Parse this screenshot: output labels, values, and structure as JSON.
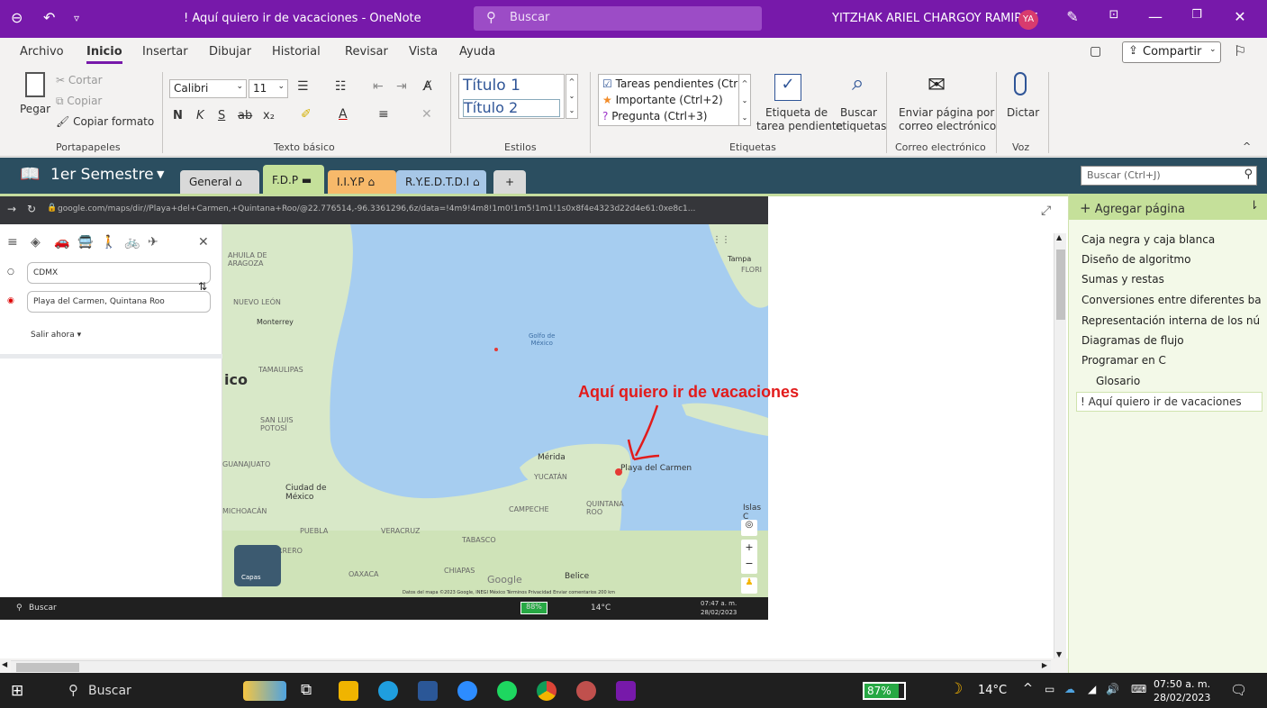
{
  "titlebar": {
    "doc_title": "! Aquí quiero ir de vacaciones  -  OneNote",
    "search_label": "Buscar",
    "user_name": "YITZHAK ARIEL CHARGOY RAMIREZ",
    "avatar_initials": "YA"
  },
  "menu": {
    "items": [
      "Archivo",
      "Inicio",
      "Insertar",
      "Dibujar",
      "Historial",
      "Revisar",
      "Vista",
      "Ayuda"
    ],
    "share_label": "Compartir"
  },
  "ribbon": {
    "clipboard": {
      "paste": "Pegar",
      "cut": "Cortar",
      "copy": "Copiar",
      "format_painter": "Copiar formato",
      "group": "Portapapeles"
    },
    "basic_text": {
      "font": "Calibri",
      "size": "11",
      "group": "Texto básico"
    },
    "styles": {
      "title1": "Título 1",
      "title2": "Título 2",
      "group": "Estilos"
    },
    "tags": {
      "items": [
        "Tareas pendientes (Ctr",
        "Importante (Ctrl+2)",
        "Pregunta (Ctrl+3)"
      ],
      "todo_tag_line1": "Etiqueta de",
      "todo_tag_line2": "tarea pendiente",
      "find_tags_line1": "Buscar",
      "find_tags_line2": "etiquetas",
      "group": "Etiquetas"
    },
    "email": {
      "line1": "Enviar página por",
      "line2": "correo electrónico",
      "group": "Correo electrónico"
    },
    "voice": {
      "dictate": "Dictar",
      "group": "Voz"
    }
  },
  "notebook": {
    "name": "1er Semestre",
    "sections": [
      {
        "label": "General",
        "color": "#d9d9d9"
      },
      {
        "label": "F.D.P",
        "color": "#c5e09a"
      },
      {
        "label": "I.I.Y.P",
        "color": "#f7b96a"
      },
      {
        "label": "R.Y.E.D.T.D.I",
        "color": "#a7c7e7"
      }
    ],
    "add_section": "+",
    "search_placeholder": "Buscar (Ctrl+J)"
  },
  "embedded_screenshot": {
    "url": "google.com/maps/dir//Playa+del+Carmen,+Quintana+Roo/@22.776514,-96.3361296,6z/data=!4m9!4m8!1m0!1m5!1m1!1s0x8f4e4323d22d4e61:0xe8c1...",
    "origin": "CDMX",
    "destination": "Playa del Carmen, Quintana Roo",
    "depart": "Salir ahora",
    "layers": "Capas",
    "map_labels": {
      "coahuila": "AHUILA DE\nARAGOZA",
      "nuevo_leon": "NUEVO LEÓN",
      "monterrey": "Monterrey",
      "tamaulipas": "TAMAULIPAS",
      "mexico": "ico",
      "san_luis": "SAN LUIS\nPOTOSÍ",
      "guanajuato": "GUANAJUATO",
      "cdmx": "Ciudad de\nMéxico",
      "michoacan": "MICHOACÁN",
      "puebla": "PUEBLA",
      "veracruz": "VERACRUZ",
      "tabasco": "TABASCO",
      "guerrero": "UERRERO",
      "oaxaca": "OAXACA",
      "chiapas": "CHIAPAS",
      "campeche": "CAMPECHE",
      "yucatan": "YUCATÁN",
      "quintana_roo": "QUINTANA\nROO",
      "merida": "Mérida",
      "playa": "Playa del Carmen",
      "belice": "Belice",
      "tampa": "Tampa",
      "florida": "FLORI",
      "islas": "Islas C",
      "golfo": "Golfo de\nMéxico",
      "google": "Google",
      "footer": "Datos del mapa ©2023 Google, INEGI   México   Términos   Privacidad   Enviar comentarios   200 km"
    },
    "taskbar_search": "Buscar",
    "battery": "88%",
    "temp": "14°C",
    "time": "07:47 a. m.",
    "date": "28/02/2023"
  },
  "annotation": "Aquí quiero ir de vacaciones",
  "pages_panel": {
    "add_page": "Agregar página",
    "pages": [
      "Caja negra y caja blanca",
      "Diseño de algoritmo",
      "Sumas y restas",
      "Conversiones entre diferentes bas",
      "Representación interna de los nú",
      "Diagramas de flujo",
      "Programar en C"
    ],
    "subpage": "Glosario",
    "selected_page": "! Aquí quiero ir de vacaciones"
  },
  "taskbar": {
    "search": "Buscar",
    "battery": "87%",
    "battery_level": 0.87,
    "temp": "14°C",
    "time": "07:50 a. m.",
    "date": "28/02/2023"
  }
}
